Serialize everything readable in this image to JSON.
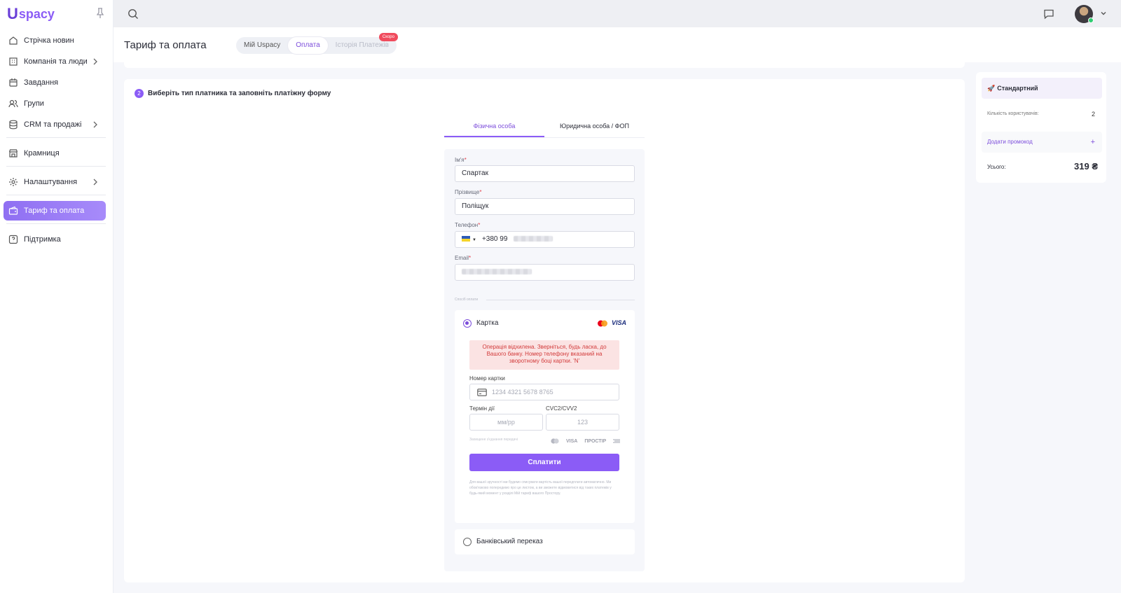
{
  "app": {
    "logo_u": "U",
    "logo_rest": "spacy"
  },
  "sidebar": {
    "items": [
      {
        "label": "Стрічка новин"
      },
      {
        "label": "Компанія та люди"
      },
      {
        "label": "Завдання"
      },
      {
        "label": "Групи"
      },
      {
        "label": "CRM та продажі"
      },
      {
        "label": "Крамниця"
      },
      {
        "label": "Налаштування"
      },
      {
        "label": "Тариф та оплата"
      },
      {
        "label": "Підтримка"
      }
    ]
  },
  "header": {
    "title": "Тариф та оплата",
    "tabs": [
      {
        "label": "Мій Uspacy"
      },
      {
        "label": "Оплата"
      },
      {
        "label": "Історія Платежів",
        "badge": "Скоро"
      }
    ]
  },
  "step": {
    "number": "2",
    "text": "Виберіть тип платника та заповніть платіжну форму"
  },
  "payer_tabs": [
    "Фізична особа",
    "Юридична особа / ФОП"
  ],
  "form": {
    "first_name": {
      "label": "Ім'я",
      "value": "Спартак"
    },
    "last_name": {
      "label": "Прізвище",
      "value": "Поліщук"
    },
    "phone": {
      "label": "Телефон",
      "value": "+380 99"
    },
    "email": {
      "label": "Email"
    },
    "required_mark": "*",
    "payment_method_label": "Спосіб оплати"
  },
  "card_payment": {
    "label": "Картка",
    "visa": "VISA",
    "error": "Операція відхилена. Зверніться, будь ласка, до Вашого банку. Номер телефону вказаний на зворотному боці картки. 'N'",
    "card_number_label": "Номер картки",
    "card_number_placeholder": "1234 4321 5678 8765",
    "expiry_label": "Термін дії",
    "expiry_placeholder": "мм/рр",
    "cvc_label": "CVC2/CVV2",
    "cvc_placeholder": "123",
    "secure_text": "Захищене з'єднання передачі",
    "brands": [
      "VISA",
      "ПРОСТІР"
    ],
    "pay_button": "Сплатити",
    "fine_print": "Для вашої зручності ми будемо списувати вартість вашої передплати автоматично. Ми обов'язково попередимо про це листом, а ви зможете відмовитися від таких платежів у будь-який момент у розділі Мій тариф вашого Простору."
  },
  "bank_transfer": {
    "label": "Банківський переказ"
  },
  "summary": {
    "plan": "Стандартний",
    "users_label": "Кількість користувачів:",
    "users_value": "2",
    "promo": "Додати промокод",
    "promo_plus": "+",
    "total_label": "Усього:",
    "total_value": "319 ₴"
  },
  "colors": {
    "accent": "#8b5cf6",
    "error_bg": "#fbe3e3",
    "error_text": "#d23a3a",
    "badge": "#f04b5d"
  }
}
